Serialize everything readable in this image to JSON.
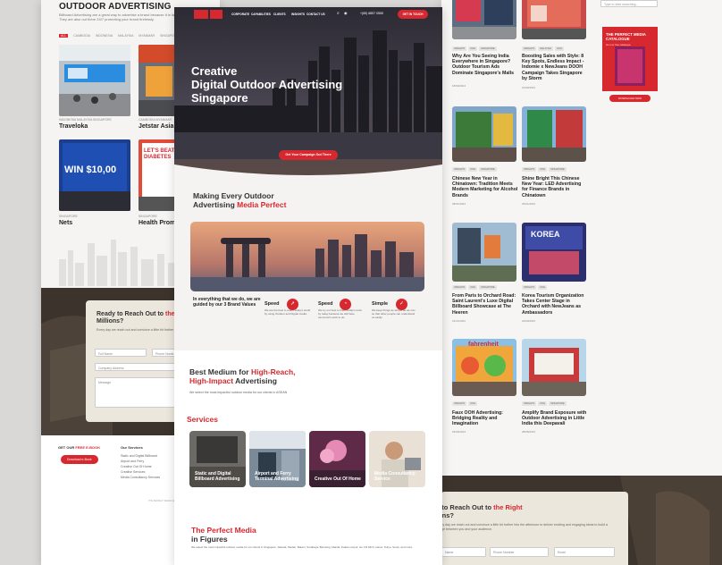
{
  "left_page": {
    "title": "OUTDOOR ADVERTISING",
    "intro_lines": [
      "Billboard Advertising are a great way to advertise a brand because it is larger the",
      "They are also out there 24/7 promoting your brand tirelessly."
    ],
    "tabs": [
      "ALL",
      "CAMBODIA",
      "INDONESIA",
      "MALAYSIA",
      "MYANMAR",
      "SINGAPORE"
    ],
    "cards": [
      {
        "small": "INDONESIA MALAYSIA SINGAPORE",
        "name": "Traveloka"
      },
      {
        "small": "CAMBODIA MYANMAR",
        "name": "Jetstar Asia"
      },
      {
        "small": "SINGAPORE",
        "name": "Nets",
        "img_text": "WIN $10,00"
      },
      {
        "small": "SINGAPORE",
        "name": "Health Promo",
        "img_text": "LET'S BEAT DIABETES"
      }
    ],
    "form": {
      "heading_pre": "Ready to Reach Out to ",
      "heading_accent": "the Ri",
      "heading_post": "Millions?",
      "sub": "Every day we reach out and convince a little bit further into the afternoon",
      "fields": {
        "full_name": "Full Name",
        "phone": "Phone Numb",
        "company": "Company Address",
        "message": "Message"
      }
    },
    "footer": {
      "ebook_pre": "GET OUR ",
      "ebook_accent": "FREE E-BOOK",
      "download": "Download e-Book",
      "services_title": "Our Services",
      "services": [
        "Static and Digital Billboard",
        "Airport and Ferry",
        "Creative Out Of Home",
        "Creative Services",
        "Media Consultancy Services"
      ],
      "copyright": "THE PERFECT MEDIA GROUP"
    }
  },
  "mid_page": {
    "nav": {
      "items": [
        "CORPORATE",
        "CAPABILITIES",
        "CLIENTS",
        "INSIGHTS",
        "CONTACT US"
      ],
      "phone": "+(65) 6857 0555",
      "cta": "GET IN TOUCH"
    },
    "hero": {
      "title_lines": [
        "Creative",
        "Digital Outdoor Advertising",
        "Singapore"
      ],
      "button": "Get Your Campaign Out There"
    },
    "section1": {
      "heading_pre": "Making Every Outdoor",
      "heading_line2": "Advertising ",
      "heading_accent": "Media Perfect"
    },
    "features": {
      "intro": "In everything that we do, we are guided by our 3 Brand Values",
      "items": [
        {
          "title": "Speed",
          "icon": "rocket-icon",
          "text": "We are the best to reach today's world by using Outdoor and Digital media."
        },
        {
          "title": "Speed",
          "icon": "gauge-icon",
          "text": "We try our best to finish today's work by today because we still have tomorrow's work to do."
        },
        {
          "title": "Simple",
          "icon": "check-icon",
          "text": "We keep things as simple as we can so that other people can understand us easily."
        }
      ]
    },
    "section2": {
      "heading_pre": "Best Medium for ",
      "heading_accent1": "High-Reach,",
      "heading_accent2": "High-Impact",
      "heading_post": " Advertising",
      "sub": "We select the most impactful outdoor media for our clients in ASEAN"
    },
    "services": {
      "heading": "Services",
      "cards": [
        "Static and Digital Billboard Advertising",
        "Airport and Ferry Terminal Advertising",
        "Creative Out Of Home",
        "Media Consultancy Service"
      ]
    },
    "figures": {
      "heading_accent": "The Perfect Media",
      "heading_post": "in Figures",
      "sub": "We select the most impactful outdoor media for our clients in Singapore, Jakarta, Medan, Batam, Surabaya, Bandung, Manila, Kuala Lumpur, Ho Chi Minh, Hanoi, Tokyo, Seoul, and more."
    }
  },
  "right_page": {
    "search_placeholder": "Type to start searching...",
    "catalogue": {
      "title": "THE PERFECT MEDIA CATALOGUE",
      "sub": "Get our free catalogue",
      "button": "DOWNLOAD NOW"
    },
    "articles": [
      {
        "tags": [
          "INSIGHTS",
          "OOH",
          "SINGAPORE"
        ],
        "title": "Why Are You Seeing India Everywhere in Singapore? Outdoor Tourism Ads Dominate Singapore's Malls",
        "date": "18/09/2024"
      },
      {
        "tags": [
          "INSIGHTS",
          "MALAYSIA",
          "OOH"
        ],
        "title": "Boosting Sales with Style: 8 Key Spots, Endless Impact - Indomie x NewJeans DOOH Campaign Takes Singapore by Storm",
        "date": "10/09/2024"
      },
      {
        "tags": [
          "INSIGHTS",
          "OOH",
          "SINGAPORE"
        ],
        "title": "Chinese New Year in Chinatown: Tradition Meets Modern Marketing for Alcohol Brands",
        "date": "28/01/2024"
      },
      {
        "tags": [
          "INSIGHTS",
          "OOH",
          "SINGAPORE"
        ],
        "title": "Shine Bright This Chinese New Year: LED Advertising for Finance Brands in Chinatown",
        "date": "25/01/2024"
      },
      {
        "tags": [
          "INSIGHTS",
          "OOH",
          "SINGAPORE"
        ],
        "title": "From Paris to Orchard Road: Saint Laurent's Luxe Digital Billboard Showcase at The Heeren",
        "date": "01/11/2023",
        "img_text": ""
      },
      {
        "tags": [
          "INSIGHTS",
          "OOH"
        ],
        "title": "Korea Tourism Organization Takes Center Stage in Orchard with NewJeans as Ambassadors",
        "date": "20/09/2023",
        "img_text": "KOREA"
      },
      {
        "tags": [
          "INSIGHTS",
          "OOH"
        ],
        "title": "Faux OOH Advertising: Bridging Reality and Imagination",
        "date": "04/09/2023",
        "img_text": "fahrenheit"
      },
      {
        "tags": [
          "INSIGHTS",
          "OOH",
          "SINGAPORE"
        ],
        "title": "Amplify Brand Exposure with Outdoor Advertising in Little India this Deepavali",
        "date": "28/08/2023"
      }
    ],
    "form": {
      "heading_pre": "y to Reach Out to ",
      "heading_accent": "the Right",
      "heading_post": "ions?",
      "sub": "Every day we reach out and convince a little bit further into the afternoon to deliver exciting and engaging ideas to build a bridge between you and your audience.",
      "fields": {
        "name": "Name",
        "phone": "Phone Number",
        "email": "Email"
      }
    }
  }
}
